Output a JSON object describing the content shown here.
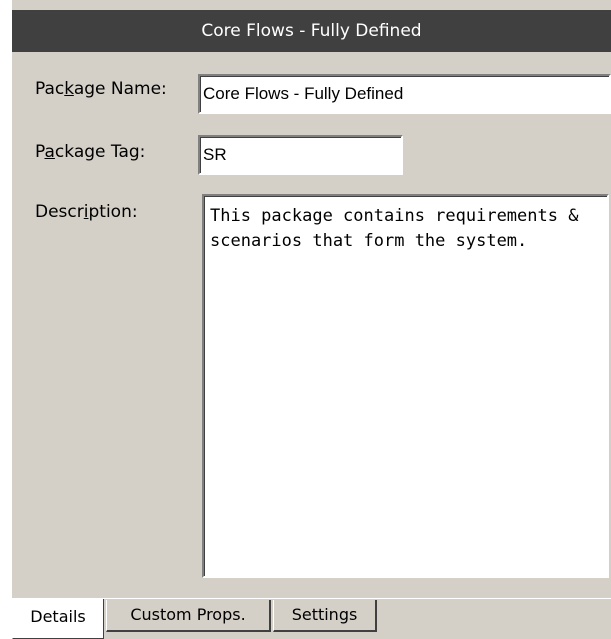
{
  "panel": {
    "title": "Core Flows - Fully Defined"
  },
  "form": {
    "package_name": {
      "label_pre": "Pac",
      "label_key": "k",
      "label_post": "age Name:",
      "value": "Core Flows - Fully Defined"
    },
    "package_tag": {
      "label_pre": "P",
      "label_key": "a",
      "label_post": "ckage Tag:",
      "value": "SR"
    },
    "description": {
      "label_pre": "Descr",
      "label_key": "i",
      "label_post": "ption:",
      "value": "This package contains requirements & scenarios that form the system."
    }
  },
  "tabs": [
    {
      "label": "Details",
      "active": true
    },
    {
      "label": "Custom Props.",
      "active": false
    },
    {
      "label": "Settings",
      "active": false
    }
  ],
  "colors": {
    "panel_bg": "#d4d0c8",
    "titlebar_bg": "#404040",
    "titlebar_text": "#ffffff",
    "field_bg": "#ffffff"
  }
}
